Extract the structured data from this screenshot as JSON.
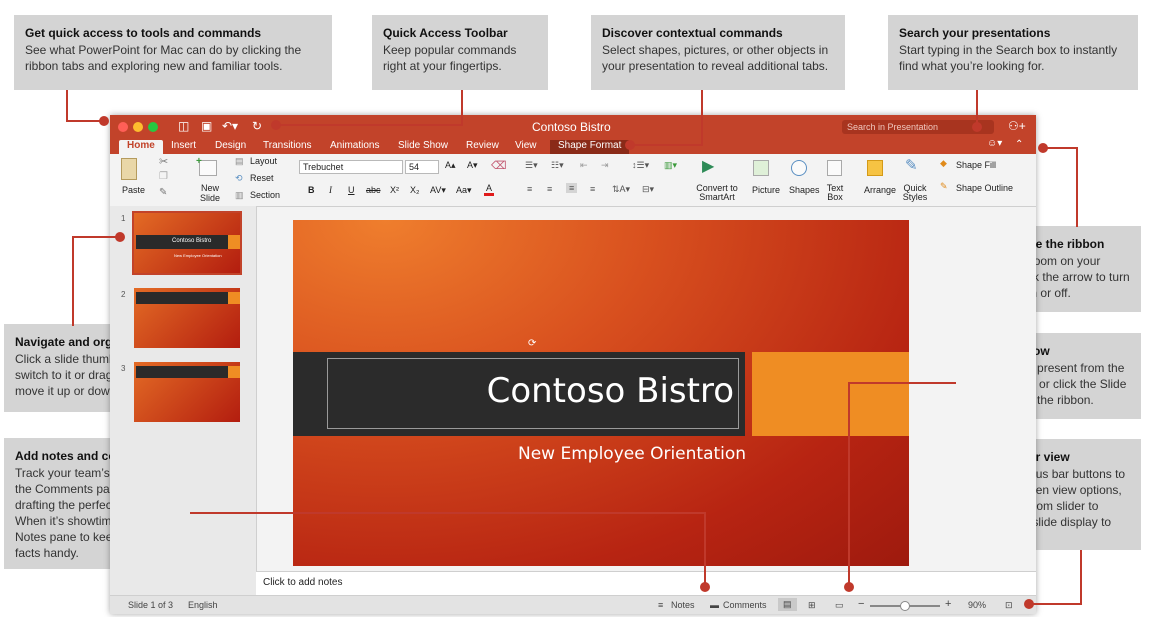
{
  "callouts": {
    "tools": {
      "title": "Get quick access to tools and commands",
      "body": "See what PowerPoint for Mac can do by clicking the ribbon tabs and exploring new and familiar tools."
    },
    "qat": {
      "title": "Quick Access Toolbar",
      "body": "Keep popular commands right at your fingertips."
    },
    "contextual": {
      "title": "Discover contextual commands",
      "body": "Select shapes, pictures, or other objects in your presentation to reveal additional tabs."
    },
    "search": {
      "title": "Search your presentations",
      "body": "Start typing in the Search box to instantly find what you’re looking for."
    },
    "ribbon": {
      "title": "Show or hide the ribbon",
      "body": "Need more room on your screen? Click the arrow to turn the ribbon on or off."
    },
    "show": {
      "title": "Start the show",
      "body": "Click here to present from the current slide, or click the Slide Show tab on the ribbon."
    },
    "view": {
      "title": "Change your view",
      "body": "Click the status bar buttons to switch between view options, or use the zoom slider to magnify the slide display to your liking."
    },
    "navigate": {
      "title": "Navigate and organize",
      "body": "Click a slide thumbnail to switch to it or drag a slide to move it up or down in the list."
    },
    "notes": {
      "title": "Add notes and comments",
      "body": "Track your team’s feedback in the Comments pane while drafting the perfect deck. When it’s showtime, use the Notes pane to keep important facts handy."
    }
  },
  "window": {
    "title": "Contoso Bistro",
    "search_placeholder": "Search in Presentation",
    "tabs": [
      "Home",
      "Insert",
      "Design",
      "Transitions",
      "Animations",
      "Slide Show",
      "Review",
      "View",
      "Shape Format"
    ],
    "active_tab": "Home"
  },
  "ribbon": {
    "paste": "Paste",
    "new_slide": "New Slide",
    "layout": "Layout",
    "reset": "Reset",
    "section": "Section",
    "font_name": "Trebuchet",
    "font_size": "54",
    "bold": "B",
    "italic": "I",
    "underline": "U",
    "strike": "abc",
    "superscript": "X²",
    "subscript": "X₂",
    "convert": "Convert to SmartArt",
    "picture": "Picture",
    "shapes": "Shapes",
    "text_box": "Text Box",
    "arrange": "Arrange",
    "quick_styles": "Quick Styles",
    "shape_fill": "Shape Fill",
    "shape_outline": "Shape Outline"
  },
  "thumbnails": [
    {
      "num": "1",
      "title": "Contoso Bistro",
      "subtitle": "New Employee Orientation"
    },
    {
      "num": "2"
    },
    {
      "num": "3"
    }
  ],
  "slide": {
    "title": "Contoso Bistro",
    "subtitle": "New Employee Orientation"
  },
  "notes_placeholder": "Click to add notes",
  "status": {
    "slide_count": "Slide 1 of 3",
    "language": "English",
    "notes": "Notes",
    "comments": "Comments",
    "zoom": "90%"
  },
  "colors": {
    "accent": "#c2432a",
    "leader": "#c0392b",
    "callout_bg": "#d4d4d4"
  }
}
